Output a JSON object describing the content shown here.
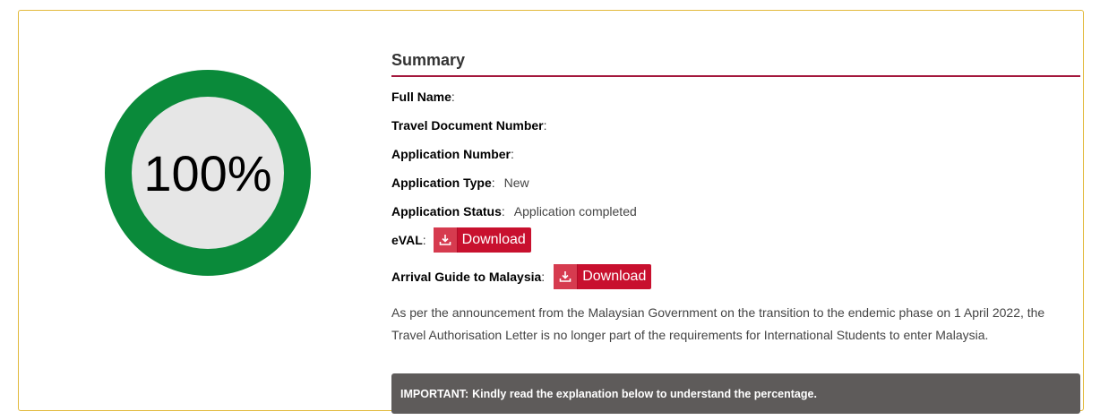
{
  "progress": {
    "value_percent": 100,
    "label": "100%",
    "ring_color": "#0a8a3a"
  },
  "summary": {
    "title": "Summary",
    "accent_color": "#a3173c",
    "fields": [
      {
        "label": "Full Name",
        "value": ""
      },
      {
        "label": "Travel Document Number",
        "value": ""
      },
      {
        "label": "Application Number",
        "value": ""
      },
      {
        "label": "Application Type",
        "value": "New"
      },
      {
        "label": "Application Status",
        "value": "Application completed"
      }
    ],
    "downloads": [
      {
        "label": "eVAL",
        "button_label": "Download",
        "icon": "download-icon"
      },
      {
        "label": "Arrival Guide to Malaysia",
        "button_label": "Download",
        "icon": "download-icon"
      }
    ],
    "note": "As per the announcement from the Malaysian Government on the transition to the endemic phase on 1 April 2022, the Travel Authorisation Letter is no longer part of the requirements for International Students to enter Malaysia.",
    "important": {
      "prefix": "IMPORTANT:",
      "text": "Kindly read the explanation below to understand the percentage."
    }
  },
  "colors": {
    "button": "#c8102e",
    "card_border": "#e2b93b",
    "important_bg": "#5e5b5a"
  }
}
